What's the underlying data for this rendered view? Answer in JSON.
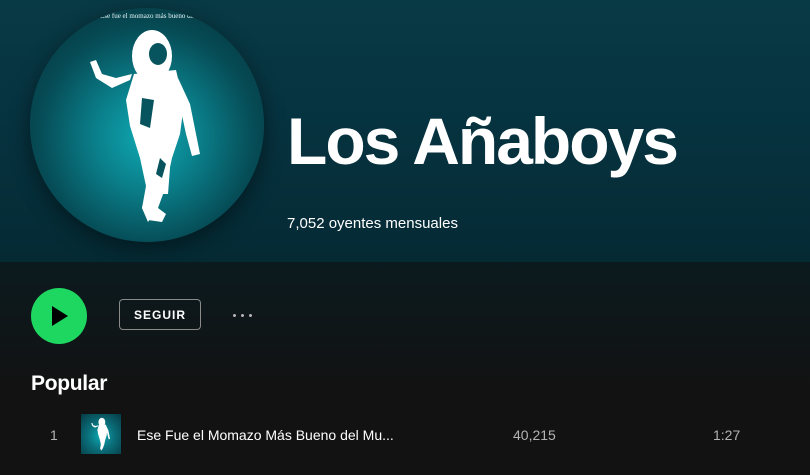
{
  "artist": {
    "name": "Los Añaboys",
    "monthly_listeners": "7,052 oyentes mensuales",
    "avatar_caption": "Ese fue el momazo más bueno del"
  },
  "actions": {
    "follow_label": "SEGUIR",
    "play_icon": "play-icon",
    "more_icon": "more-options-icon"
  },
  "popular": {
    "title": "Popular",
    "tracks": [
      {
        "number": "1",
        "title": "Ese Fue el Momazo Más Bueno del Mu...",
        "plays": "40,215",
        "duration": "1:27"
      }
    ]
  },
  "colors": {
    "accent": "#1ed760",
    "hero": "#063340",
    "background": "#121212"
  }
}
